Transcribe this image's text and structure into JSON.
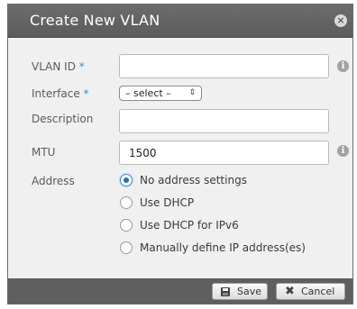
{
  "dialog": {
    "title": "Create New VLAN",
    "close_icon": "close-icon"
  },
  "form": {
    "vlan_id": {
      "label": "VLAN ID",
      "required_mark": "*",
      "value": ""
    },
    "interface": {
      "label": "Interface",
      "required_mark": "*",
      "selected": "– select –"
    },
    "description": {
      "label": "Description",
      "value": ""
    },
    "mtu": {
      "label": "MTU",
      "value": "1500"
    },
    "address": {
      "label": "Address",
      "options": [
        {
          "label": "No address settings",
          "checked": true
        },
        {
          "label": "Use DHCP",
          "checked": false
        },
        {
          "label": "Use DHCP for IPv6",
          "checked": false
        },
        {
          "label": "Manually define IP address(es)",
          "checked": false
        }
      ]
    }
  },
  "footer": {
    "save_label": "Save",
    "cancel_label": "Cancel"
  },
  "colors": {
    "title_bar": "#5f5f5f",
    "required": "#3b8fd6",
    "radio_selected": "#2e6ab8"
  }
}
